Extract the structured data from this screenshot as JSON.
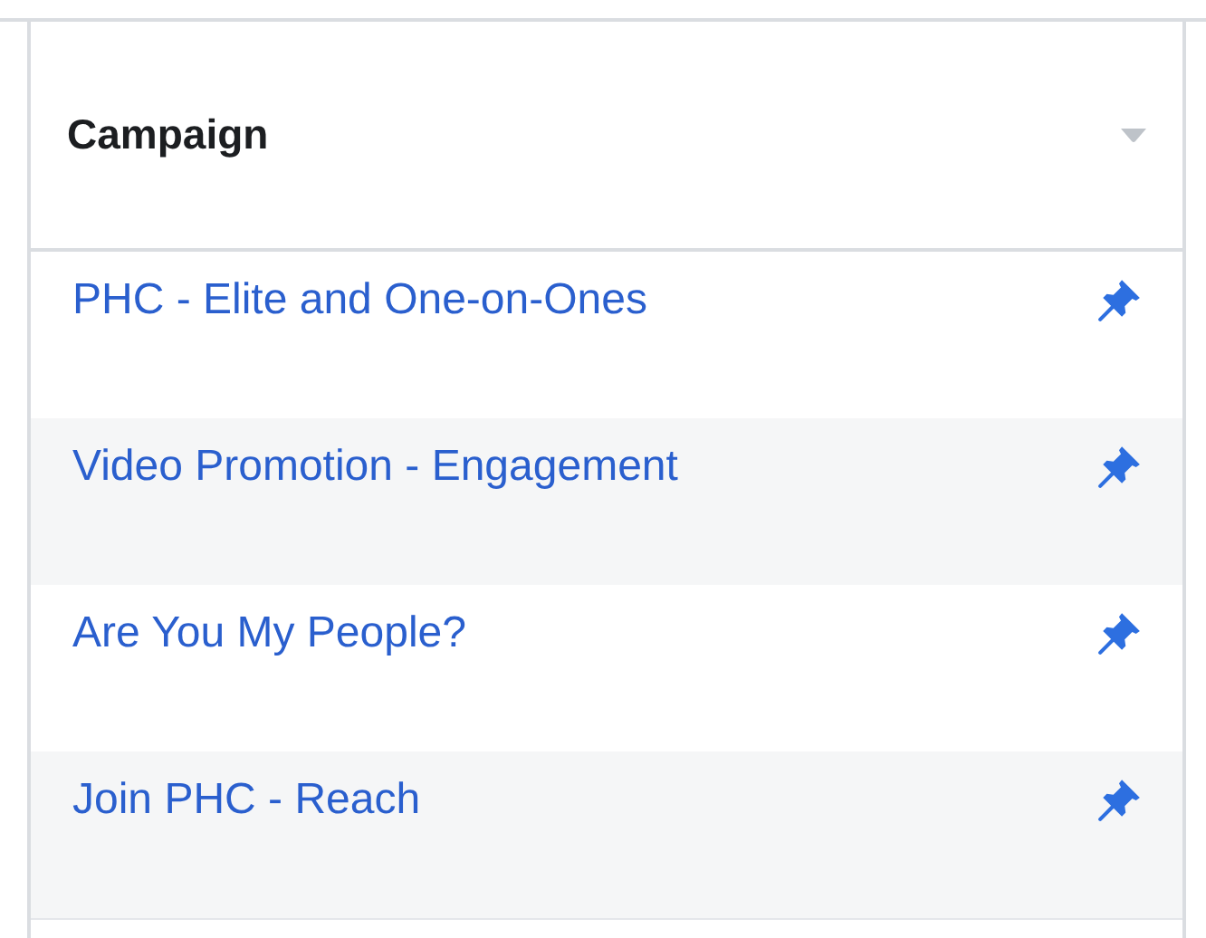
{
  "table": {
    "columns": [
      {
        "label": "Campaign"
      }
    ],
    "rows": [
      {
        "campaign": "PHC - Elite and One-on-Ones",
        "pinned": true
      },
      {
        "campaign": "Video Promotion - Engagement",
        "pinned": true
      },
      {
        "campaign": "Are You My People?",
        "pinned": true
      },
      {
        "campaign": "Join PHC - Reach",
        "pinned": true
      }
    ]
  }
}
